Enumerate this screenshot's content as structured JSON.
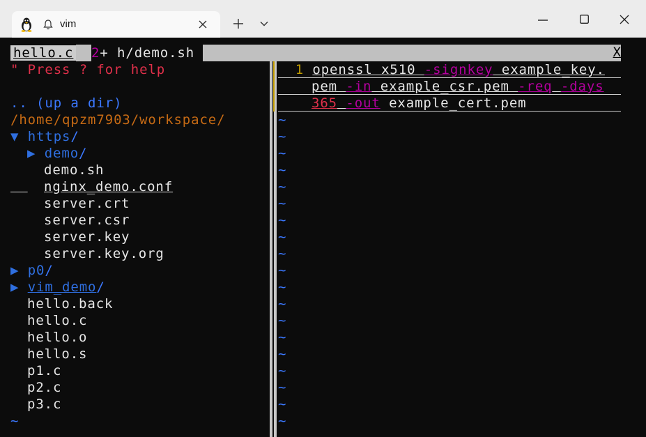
{
  "window": {
    "tab_title": "vim",
    "icons": [
      "linux-tux-icon",
      "bell-icon",
      "close-icon",
      "plus-icon",
      "chevron-down-icon",
      "minimize-icon",
      "maximize-icon",
      "close-window-icon"
    ]
  },
  "vim": {
    "tabline": {
      "active_tab": "hello.c",
      "tab2_count": "2",
      "tab2_label": "+ h/demo.sh",
      "close": "X"
    },
    "netrw": {
      "help": "\" Press ? for help",
      "up_dir": ".. (up a dir)",
      "cwd": "/home/qpzm7903/workspace/",
      "tree": [
        {
          "marker": "▼",
          "name": "https",
          "suffix": "/"
        },
        {
          "marker": "▶",
          "name": "demo",
          "suffix": "/"
        },
        {
          "name": "demo.sh"
        },
        {
          "name": "nginx_demo.conf"
        },
        {
          "name": "server.crt"
        },
        {
          "name": "server.csr"
        },
        {
          "name": "server.key"
        },
        {
          "name": "server.key.org"
        },
        {
          "marker": "▶",
          "name": "p0",
          "suffix": "/"
        },
        {
          "marker": "▶",
          "name": "vim_demo",
          "suffix": "/"
        },
        {
          "name": "hello.back"
        },
        {
          "name": "hello.c"
        },
        {
          "name": "hello.o"
        },
        {
          "name": "hello.s"
        },
        {
          "name": "p1.c"
        },
        {
          "name": "p2.c"
        },
        {
          "name": "p3.c"
        }
      ],
      "tilde": "~"
    },
    "buffer": {
      "line_number": "1",
      "line1": {
        "a": "openssl x510 ",
        "b": "-signkey",
        "c": " example_key."
      },
      "line2": {
        "a": "pem ",
        "b": "-in",
        "c": " example_csr.pem ",
        "d": "-req",
        "e": " ",
        "f": "-days"
      },
      "line3": {
        "a": "365",
        "b": " ",
        "c": "-out",
        "d": " example_cert.pem"
      },
      "tilde": "~"
    }
  },
  "colors": {
    "terminal_bg": "#0c0c0c",
    "comment_red": "#e0304a",
    "dir_blue": "#3b78ff",
    "path_orange": "#c66a14",
    "option_purple": "#b4009e",
    "line_number_yellow": "#c19c00"
  }
}
